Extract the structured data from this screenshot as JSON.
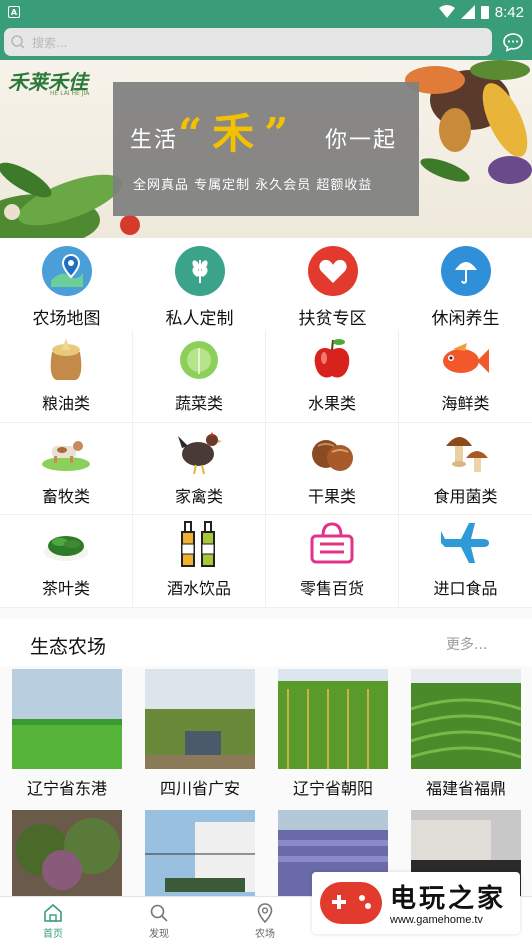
{
  "status_bar": {
    "time": "8:42"
  },
  "search": {
    "placeholder": "搜索..."
  },
  "banner": {
    "logo": "禾莱禾佳",
    "logo_sub": "HE LAI HE JIA",
    "line1": "生活",
    "quote": "“禾”",
    "line2": "你一起",
    "subtitle": "全网真品  专属定制  永久会员  超额收益"
  },
  "quick_entries": [
    {
      "label": "农场地图",
      "icon": "map-pin-icon",
      "color": "#4a9fd8"
    },
    {
      "label": "私人定制",
      "icon": "wheat-icon",
      "color": "#3aa38a"
    },
    {
      "label": "扶贫专区",
      "icon": "heart-icon",
      "color": "#e23b2e"
    },
    {
      "label": "休闲养生",
      "icon": "umbrella-icon",
      "color": "#2f8fd8"
    }
  ],
  "categories": [
    {
      "label": "粮油类",
      "icon": "grain-sack-icon"
    },
    {
      "label": "蔬菜类",
      "icon": "cabbage-icon"
    },
    {
      "label": "水果类",
      "icon": "apple-icon"
    },
    {
      "label": "海鲜类",
      "icon": "fish-icon"
    },
    {
      "label": "畜牧类",
      "icon": "cow-icon"
    },
    {
      "label": "家禽类",
      "icon": "chicken-icon"
    },
    {
      "label": "干果类",
      "icon": "nut-icon"
    },
    {
      "label": "食用菌类",
      "icon": "mushroom-icon"
    },
    {
      "label": "茶叶类",
      "icon": "tea-leaf-icon"
    },
    {
      "label": "酒水饮品",
      "icon": "bottles-icon"
    },
    {
      "label": "零售百货",
      "icon": "basket-icon"
    },
    {
      "label": "进口食品",
      "icon": "plane-icon"
    }
  ],
  "farm_section": {
    "title": "生态农场",
    "more": "更多...",
    "farms": [
      {
        "label": "辽宁省东港"
      },
      {
        "label": "四川省广安"
      },
      {
        "label": "辽宁省朝阳"
      },
      {
        "label": "福建省福鼎"
      }
    ]
  },
  "bottom_nav": [
    {
      "label": "首页",
      "icon": "home-icon"
    },
    {
      "label": "发现",
      "icon": "search-icon"
    },
    {
      "label": "农场",
      "icon": "location-icon"
    },
    {
      "label": "",
      "icon": ""
    },
    {
      "label": "",
      "icon": ""
    }
  ],
  "watermark": {
    "title": "电玩之家",
    "url": "www.gamehome.tv"
  }
}
